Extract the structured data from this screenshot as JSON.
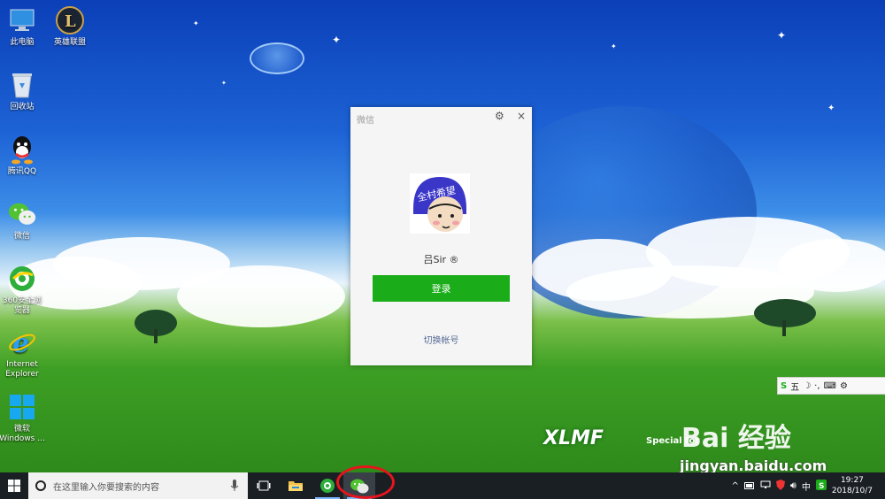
{
  "desktop": {
    "icons": [
      {
        "label": "此电脑",
        "icon": "computer-icon"
      },
      {
        "label": "英雄联盟",
        "icon": "league-of-legends-icon"
      },
      {
        "label": "回收站",
        "icon": "recycle-bin-icon"
      },
      {
        "label": "腾讯QQ",
        "icon": "qq-icon"
      },
      {
        "label": "微信",
        "icon": "wechat-icon"
      },
      {
        "label": "360安全浏览器",
        "icon": "360-browser-icon"
      },
      {
        "label": "Internet Explorer",
        "icon": "internet-explorer-icon"
      },
      {
        "label": "微软 Windows ...",
        "icon": "windows-icon"
      }
    ],
    "wallpaper_brand": "XLMF",
    "wallpaper_subtext": "Special for",
    "watermark": {
      "brand": "Bai 经验",
      "url": "jingyan.baidu.com"
    }
  },
  "wechat_window": {
    "title": "微信",
    "settings_label": "⚙",
    "close_label": "×",
    "avatar_text": "全村希望",
    "username": "吕Sir ®",
    "login_label": "登录",
    "switch_account_label": "切换帐号",
    "login_button_color": "#1aad19"
  },
  "ime_bar": {
    "mode": "五",
    "items": [
      "☽",
      "·,",
      "⌨",
      "⚙"
    ]
  },
  "taskbar": {
    "search_placeholder": "在这里输入你要搜索的内容",
    "apps": [
      "task-view-icon",
      "file-explorer-icon",
      "360-browser-icon",
      "wechat-icon"
    ],
    "active_app": "wechat-icon",
    "clock": {
      "time": "19:27",
      "date": "2018/10/7"
    }
  },
  "annotation": {
    "highlight_color": "#e8141c"
  }
}
